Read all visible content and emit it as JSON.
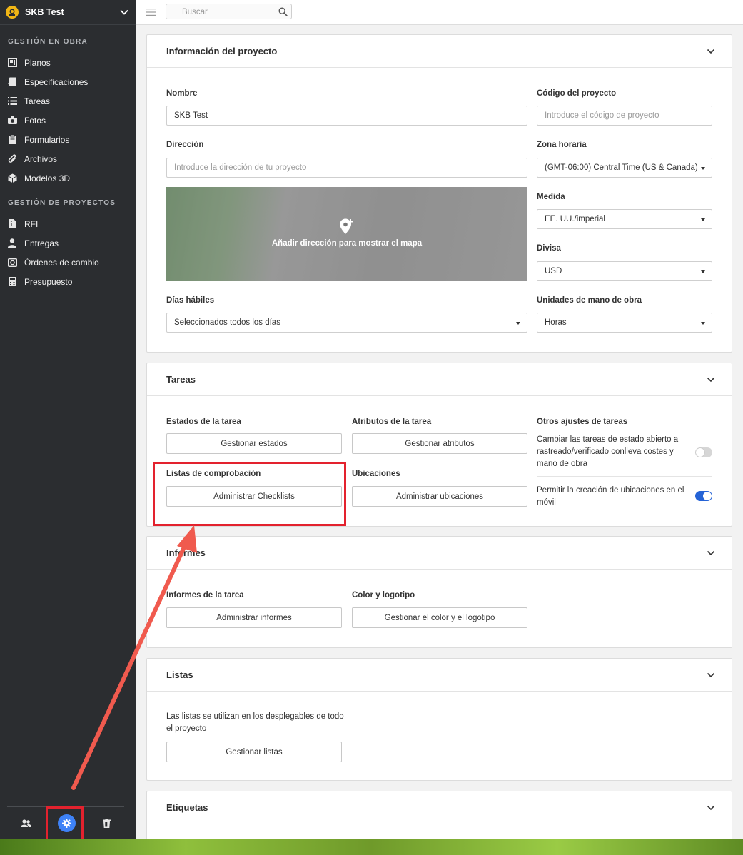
{
  "sidebar": {
    "title": "SKB Test",
    "sections": [
      {
        "label": "GESTIÓN EN OBRA",
        "items": [
          "Planos",
          "Especificaciones",
          "Tareas",
          "Fotos",
          "Formularios",
          "Archivos",
          "Modelos 3D"
        ]
      },
      {
        "label": "GESTIÓN DE PROYECTOS",
        "items": [
          "RFI",
          "Entregas",
          "Órdenes de cambio",
          "Presupuesto"
        ]
      }
    ],
    "icons": [
      "plans-icon",
      "specs-icon",
      "list-icon",
      "camera-icon",
      "clipboard-icon",
      "paperclip-icon",
      "cube-icon",
      "rfi-icon",
      "user-icon",
      "change-order-icon",
      "calculator-icon"
    ]
  },
  "topbar": {
    "search_placeholder": "Buscar"
  },
  "project_info": {
    "title": "Información del proyecto",
    "name_label": "Nombre",
    "name_value": "SKB Test",
    "code_label": "Código del proyecto",
    "code_placeholder": "Introduce el código de proyecto",
    "address_label": "Dirección",
    "address_placeholder": "Introduce la dirección de tu proyecto",
    "map_text": "Añadir dirección para mostrar el mapa",
    "timezone_label": "Zona horaria",
    "timezone_value": "(GMT-06:00) Central Time (US & Canada)",
    "measure_label": "Medida",
    "measure_value": "EE. UU./imperial",
    "currency_label": "Divisa",
    "currency_value": "USD",
    "workdays_label": "Días hábiles",
    "workdays_value": "Seleccionados todos los días",
    "labor_label": "Unidades de mano de obra",
    "labor_value": "Horas"
  },
  "tasks": {
    "title": "Tareas",
    "states_label": "Estados de la tarea",
    "states_button": "Gestionar estados",
    "attributes_label": "Atributos de la tarea",
    "attributes_button": "Gestionar atributos",
    "other_label": "Otros ajustes de tareas",
    "setting1_text": "Cambiar las tareas de estado abierto a rastreado/verificado conlleva costes y mano de obra",
    "setting1_on": false,
    "setting2_text": "Permitir la creación de ubicaciones en el móvil",
    "setting2_on": true,
    "checklists_label": "Listas de comprobación",
    "checklists_button": "Administrar Checklists",
    "locations_label": "Ubicaciones",
    "locations_button": "Administrar ubicaciones"
  },
  "reports": {
    "title": "Informes",
    "task_reports_label": "Informes de la tarea",
    "task_reports_button": "Administrar informes",
    "color_label": "Color y logotipo",
    "color_button": "Gestionar el color y el logotipo"
  },
  "lists": {
    "title": "Listas",
    "description": "Las listas se utilizan en los desplegables de todo el proyecto",
    "button": "Gestionar listas"
  },
  "tags": {
    "title": "Etiquetas"
  },
  "colors": {
    "accent": "#3e82f7",
    "highlight": "#e3222e",
    "sidebar": "#2b2d30"
  }
}
